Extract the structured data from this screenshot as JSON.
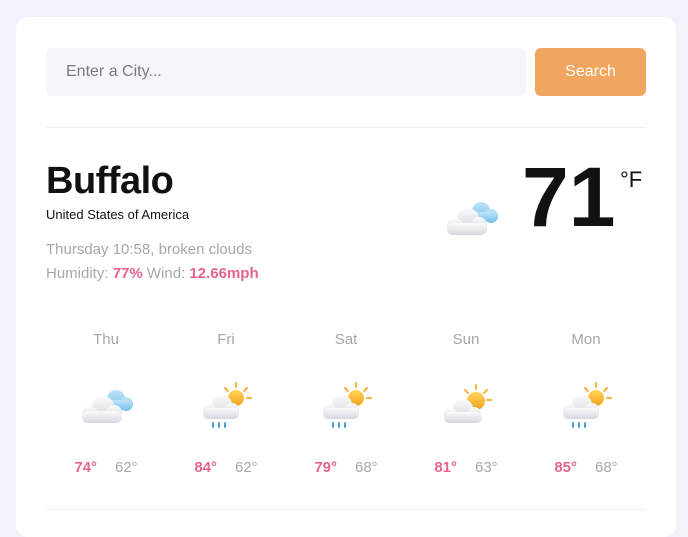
{
  "search": {
    "placeholder": "Enter a City...",
    "button_label": "Search"
  },
  "current": {
    "city": "Buffalo",
    "country": "United States of America",
    "description": "Thursday 10:58, broken clouds",
    "humidity_label": "Humidity:",
    "humidity_value": "77%",
    "wind_label": "Wind:",
    "wind_value": "12.66mph",
    "temperature": "71",
    "unit": "°F",
    "icon": "cloudy-icon"
  },
  "forecast": [
    {
      "day": "Thu",
      "high": "74°",
      "low": "62°",
      "icon": "cloudy-icon"
    },
    {
      "day": "Fri",
      "high": "84°",
      "low": "62°",
      "icon": "sun-cloud-rain-icon"
    },
    {
      "day": "Sat",
      "high": "79°",
      "low": "68°",
      "icon": "sun-cloud-rain-icon"
    },
    {
      "day": "Sun",
      "high": "81°",
      "low": "63°",
      "icon": "partly-cloudy-icon"
    },
    {
      "day": "Mon",
      "high": "85°",
      "low": "68°",
      "icon": "sun-cloud-rain-icon"
    }
  ],
  "colors": {
    "accent": "#e4648c",
    "button": "#f0a65e",
    "muted": "#a6a6ab"
  }
}
